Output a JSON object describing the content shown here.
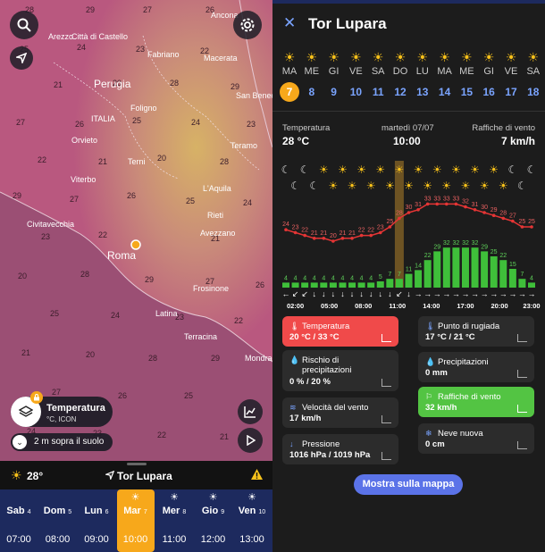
{
  "map": {
    "cities": [
      "Ancona",
      "Arezzo",
      "Città di Castello",
      "Fabriano",
      "Macerata",
      "Perugia",
      "San Benedetto del Tronto",
      "ITALIA",
      "Foligno",
      "Orvieto",
      "Teramo",
      "Terni",
      "Viterbo",
      "L'Aquila",
      "Rieti",
      "Civitavecchia",
      "Avezzano",
      "Roma",
      "Frosinone",
      "Latina",
      "Terracina",
      "Mondragone"
    ],
    "numbers": [
      "28",
      "29",
      "27",
      "26",
      "25",
      "24",
      "23",
      "22",
      "21",
      "20"
    ],
    "layer_title": "Temperatura",
    "layer_sub": "°C, ICON",
    "height_label": "2 m sopra il suolo",
    "bottom_temp": "28°",
    "bottom_place": "Tor Lupara",
    "days": [
      {
        "name": "Sab",
        "num": "4",
        "time": "07:00"
      },
      {
        "name": "Dom",
        "num": "5",
        "time": "08:00"
      },
      {
        "name": "Lun",
        "num": "6",
        "time": "09:00"
      },
      {
        "name": "Mar",
        "num": "7",
        "time": "10:00"
      },
      {
        "name": "Mer",
        "num": "8",
        "time": "11:00"
      },
      {
        "name": "Gio",
        "num": "9",
        "time": "12:00"
      },
      {
        "name": "Ven",
        "num": "10",
        "time": "13:00"
      }
    ]
  },
  "detail": {
    "title": "Tor Lupara",
    "days": [
      {
        "l": "MA",
        "n": "7"
      },
      {
        "l": "ME",
        "n": "8"
      },
      {
        "l": "GI",
        "n": "9"
      },
      {
        "l": "VE",
        "n": "10"
      },
      {
        "l": "SA",
        "n": "11"
      },
      {
        "l": "DO",
        "n": "12"
      },
      {
        "l": "LU",
        "n": "13"
      },
      {
        "l": "MA",
        "n": "14"
      },
      {
        "l": "ME",
        "n": "15"
      },
      {
        "l": "GI",
        "n": "16"
      },
      {
        "l": "VE",
        "n": "17"
      },
      {
        "l": "SA",
        "n": "18"
      }
    ],
    "sum_temp_label": "Temperatura",
    "sum_temp_value": "28 °C",
    "sum_date": "martedì 07/07",
    "sum_time": "10:00",
    "sum_wind_label": "Raffiche di vento",
    "sum_wind_value": "7 km/h",
    "temps": [
      24,
      23,
      22,
      21,
      21,
      20,
      21,
      21,
      22,
      22,
      23,
      25,
      28,
      30,
      31,
      33,
      33,
      33,
      33,
      32,
      31,
      30,
      29,
      28,
      27,
      25,
      25
    ],
    "gusts": [
      4,
      4,
      4,
      4,
      4,
      4,
      4,
      4,
      4,
      4,
      5,
      7,
      7,
      11,
      14,
      22,
      29,
      32,
      32,
      32,
      32,
      29,
      25,
      22,
      15,
      7,
      4
    ],
    "arrows": [
      "←",
      "↙",
      "↙",
      "↓",
      "↓",
      "↓",
      "↓",
      "↓",
      "↓",
      "↓",
      "↓",
      "↓",
      "↙",
      "↓",
      "→",
      "→",
      "→",
      "→",
      "→",
      "→",
      "→",
      "→",
      "→",
      "→",
      "→",
      "→",
      "→"
    ],
    "times": [
      "02:00",
      "05:00",
      "08:00",
      "11:00",
      "14:00",
      "17:00",
      "20:00",
      "23:00"
    ],
    "cards": [
      {
        "label": "Temperatura",
        "value": "20 °C / 33 °C"
      },
      {
        "label": "Punto di rugiada",
        "value": "17 °C / 21 °C"
      },
      {
        "label": "Rischio di precipitazioni",
        "value": "0 % / 20 %"
      },
      {
        "label": "Precipitazioni",
        "value": "0 mm"
      },
      {
        "label": "Velocità del vento",
        "value": "17 km/h"
      },
      {
        "label": "Raffiche di vento",
        "value": "32 km/h"
      },
      {
        "label": "Pressione",
        "value": "1016 hPa / 1019 hPa"
      },
      {
        "label": "Neve nuova",
        "value": "0 cm"
      }
    ],
    "show_map": "Mostra sulla mappa",
    "colors": {
      "accent": "#f7a81b",
      "blue_day": "#7aa4ff",
      "temp_card": "#f04a4a",
      "gust_card": "#53c443",
      "bar": "#3fbf3a",
      "line": "#e53535",
      "map_btn": "#5b73e8"
    }
  }
}
